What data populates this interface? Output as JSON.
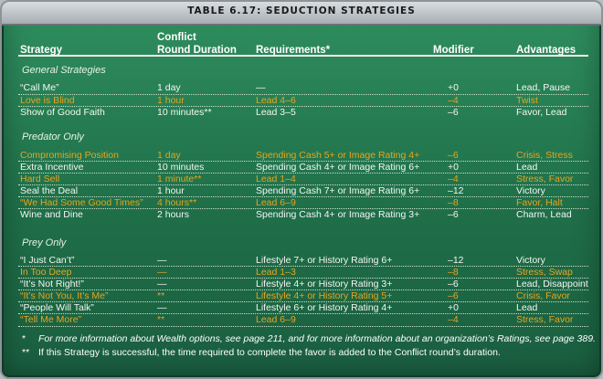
{
  "title": "TABLE 6.17: SEDUCTION STRATEGIES",
  "headers": {
    "strategy": "Strategy",
    "duration_line1": "Conflict",
    "duration_line2": "Round Duration",
    "requirements": "Requirements*",
    "modifier": "Modifier",
    "advantages": "Advantages"
  },
  "sections": {
    "general": "General Strategies",
    "predator": "Predator Only",
    "prey": "Prey Only"
  },
  "rows": [
    {
      "strategy": "“Call Me”",
      "duration": "1 day",
      "requirements": "—",
      "modifier": "+0",
      "advantages": "Lead, Pause"
    },
    {
      "strategy": "Love is Blind",
      "duration": "1 hour",
      "requirements": "Lead 4–6",
      "modifier": "–4",
      "advantages": "Twist"
    },
    {
      "strategy": "Show of Good Faith",
      "duration": "10 minutes**",
      "requirements": "Lead 3–5",
      "modifier": "–6",
      "advantages": "Favor, Lead"
    },
    {
      "strategy": "Compromising Position",
      "duration": "1 day",
      "requirements": "Spending Cash 5+ or Image Rating 4+",
      "modifier": "–6",
      "advantages": "Crisis, Stress"
    },
    {
      "strategy": "Extra Incentive",
      "duration": "10 minutes",
      "requirements": "Spending Cash 4+ or Image Rating 6+",
      "modifier": "+0",
      "advantages": "Lead"
    },
    {
      "strategy": "Hard Sell",
      "duration": "1 minute**",
      "requirements": "Lead 1–4",
      "modifier": "–4",
      "advantages": "Stress, Favor"
    },
    {
      "strategy": "Seal the Deal",
      "duration": "1 hour",
      "requirements": "Spending Cash 7+ or Image Rating 6+",
      "modifier": "–12",
      "advantages": "Victory"
    },
    {
      "strategy": "“We Had Some Good Times”",
      "duration": "4 hours**",
      "requirements": "Lead 6–9",
      "modifier": "–8",
      "advantages": "Favor, Halt"
    },
    {
      "strategy": "Wine and Dine",
      "duration": "2 hours",
      "requirements": "Spending Cash 4+ or Image Rating 3+",
      "modifier": "–6",
      "advantages": "Charm, Lead"
    },
    {
      "strategy": "“I Just Can’t”",
      "duration": "—",
      "requirements": "Lifestyle 7+ or History Rating 6+",
      "modifier": "–12",
      "advantages": "Victory"
    },
    {
      "strategy": "In Too Deep",
      "duration": "—",
      "requirements": "Lead 1–3",
      "modifier": "–8",
      "advantages": "Stress, Swap"
    },
    {
      "strategy": "“It’s Not Right!”",
      "duration": "—",
      "requirements": "Lifestyle 4+ or History Rating 3+",
      "modifier": "–6",
      "advantages": "Lead, Disappoint"
    },
    {
      "strategy": "“It’s Not You, It’s Me”",
      "duration": "**",
      "requirements": "Lifestyle 4+ or History Rating 5+",
      "modifier": "–6",
      "advantages": "Crisis, Favor"
    },
    {
      "strategy": "“People Will Talk”",
      "duration": "—",
      "requirements": "Lifestyle 6+ or History Rating 4+",
      "modifier": "+0",
      "advantages": "Lead"
    },
    {
      "strategy": "“Tell Me More”",
      "duration": "**",
      "requirements": "Lead 6–9",
      "modifier": "–4",
      "advantages": "Stress, Favor"
    }
  ],
  "footnotes": {
    "f1_mark": "*",
    "f1_text": "For more information about Wealth options, see page 211, and for more information about an organization’s Ratings, see page 389.",
    "f2_mark": "**",
    "f2_text": "If this Strategy is successful, the time required to complete the favor is added to the Conflict round’s duration."
  },
  "colors": {
    "panel_green": "#2f8f5f",
    "orange_row": "#e7a51e",
    "white_row": "#f4f7f2",
    "titlebar_gray": "#c3c8cc"
  }
}
